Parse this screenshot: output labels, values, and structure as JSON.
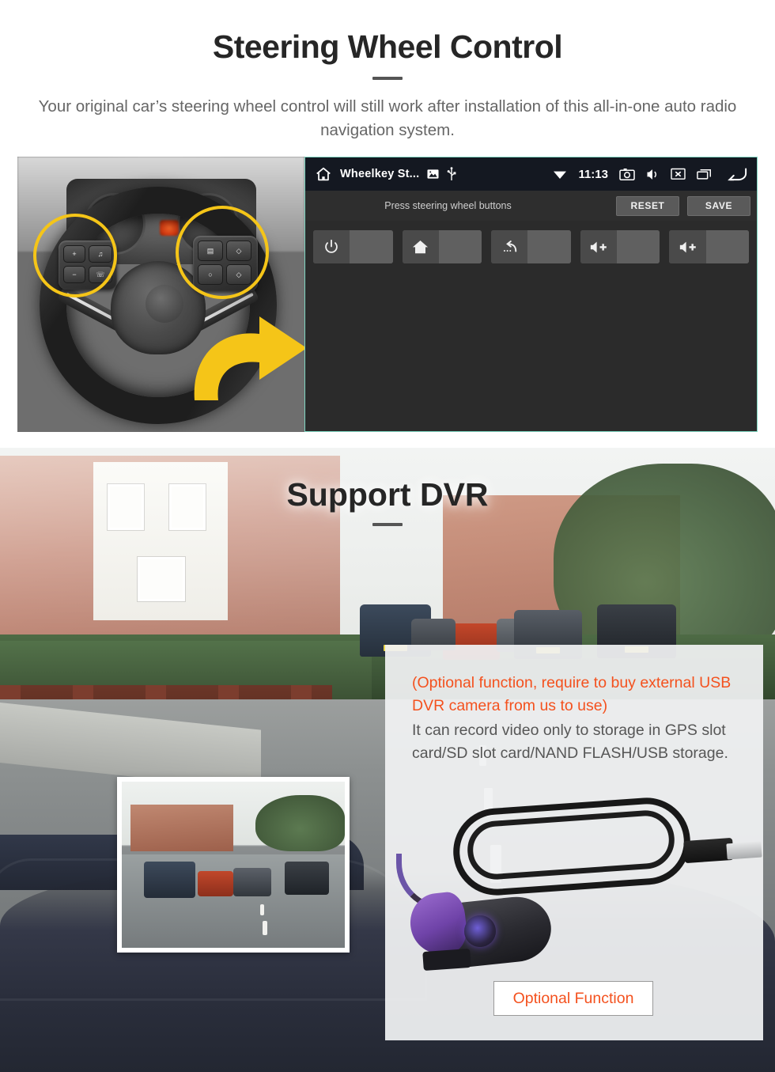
{
  "section1": {
    "title": "Steering Wheel Control",
    "subtitle": "Your original car’s steering wheel control will still work after installation of this all-in-one auto radio navigation system.",
    "android": {
      "statusbar": {
        "home_icon": "home-icon",
        "app_title": "Wheelkey St...",
        "gallery_icon": "image-icon",
        "usb_icon": "usb-icon",
        "wifi_icon": "wifi-icon",
        "time": "11:13",
        "screenshot_icon": "camera-icon",
        "mute_icon": "speaker-mute-icon",
        "screenoff_icon": "screen-off-icon",
        "recents_icon": "recent-apps-icon",
        "back_icon": "back-arrow-icon"
      },
      "command_bar": {
        "hint": "Press steering wheel buttons",
        "reset_label": "RESET",
        "save_label": "SAVE"
      },
      "keys": [
        {
          "name": "power-key",
          "icon": "power-icon",
          "value": ""
        },
        {
          "name": "home-key",
          "icon": "home-icon",
          "value": ""
        },
        {
          "name": "back-key",
          "icon": "back-icon",
          "value": ""
        },
        {
          "name": "volume-up-key-1",
          "icon": "volume-up-icon",
          "value": ""
        },
        {
          "name": "volume-up-key-2",
          "icon": "volume-up-icon",
          "value": ""
        }
      ]
    },
    "highlight_color": "#F5C518",
    "arrow_color": "#F5C518",
    "panel_border_color": "#7fd6c2"
  },
  "section2": {
    "title": "Support DVR",
    "note_orange": "(Optional function, require to buy external USB DVR camera from us to use)",
    "note_grey": "It can record video only to storage in GPS slot card/SD slot card/NAND FLASH/USB storage.",
    "optional_button_label": "Optional Function",
    "accent_color": "#F4511E",
    "panel_bg": "#f1f2f3"
  }
}
